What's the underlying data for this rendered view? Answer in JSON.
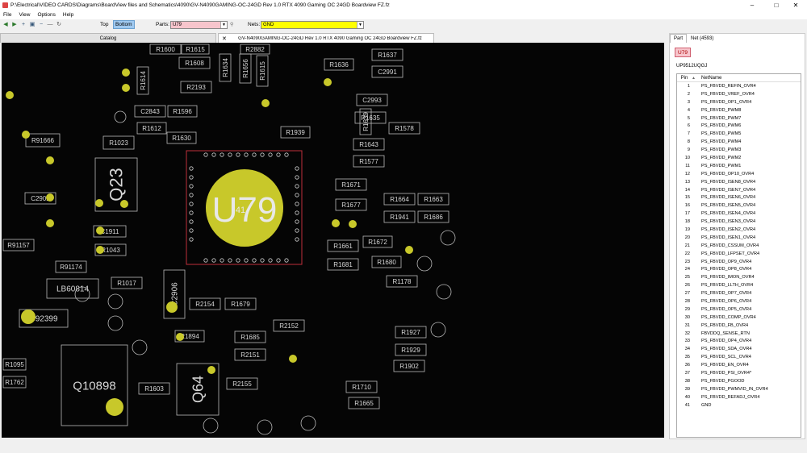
{
  "window": {
    "title": "P:\\Electrical\\VIDEO CARDS\\Diagrams\\BoardView files and Schematics\\4090\\GV-N4090GAMING-OC-24GD Rev 1.0 RTX 4090 Gaming OC 24GD Boardview FZ.fz"
  },
  "menu": [
    "File",
    "View",
    "Options",
    "Help"
  ],
  "toolbar": {
    "top_label": "Top",
    "bottom_label": "Bottom",
    "parts_label": "Parts:",
    "parts_value": "U79",
    "nets_label": "Nets:",
    "nets_value": "GND",
    "colors": {
      "parts_bg": "#f7c5cc",
      "nets_bg": "#ffff00",
      "bottom_bg": "#9fc9f0"
    }
  },
  "tabs": {
    "catalog": "Catalog",
    "file": "GV-N4090GAMING-OC-24GD Rev 1.0 RTX 4090 Gaming OC 24GD Boardview FZ.fz"
  },
  "board": {
    "main_part": "U79",
    "main_pin_label": "41",
    "colors": {
      "background": "#050505",
      "outline": "#b9b9b9",
      "highlight": "#c8c82a",
      "selected": "#c0303a"
    },
    "components": [
      {
        "label": "R1600"
      },
      {
        "label": "R1615"
      },
      {
        "label": "R2882"
      },
      {
        "label": "R1637"
      },
      {
        "label": "R1608"
      },
      {
        "label": "R1636"
      },
      {
        "label": "C2991"
      },
      {
        "label": "R1634"
      },
      {
        "label": "R2193"
      },
      {
        "label": "R1656"
      },
      {
        "label": "R1614"
      },
      {
        "label": "R1615"
      },
      {
        "label": "C2843"
      },
      {
        "label": "R1596"
      },
      {
        "label": "R1639"
      },
      {
        "label": "C2993"
      },
      {
        "label": "R1612"
      },
      {
        "label": "R1635"
      },
      {
        "label": "R1578"
      },
      {
        "label": "R1630"
      },
      {
        "label": "R1939"
      },
      {
        "label": "R1643"
      },
      {
        "label": "R1023"
      },
      {
        "label": "R91666"
      },
      {
        "label": "R1577"
      },
      {
        "label": "Q23"
      },
      {
        "label": "R1671"
      },
      {
        "label": "R1664"
      },
      {
        "label": "R1663"
      },
      {
        "label": "R1677"
      },
      {
        "label": "R1941"
      },
      {
        "label": "R1686"
      },
      {
        "label": "C2902"
      },
      {
        "label": "C1911"
      },
      {
        "label": "R1672"
      },
      {
        "label": "R1661"
      },
      {
        "label": "R1043"
      },
      {
        "label": "R1681"
      },
      {
        "label": "R1680"
      },
      {
        "label": "R91157"
      },
      {
        "label": "R91174"
      },
      {
        "label": "LB60814"
      },
      {
        "label": "R1017"
      },
      {
        "label": "C2906"
      },
      {
        "label": "R2154"
      },
      {
        "label": "R1679"
      },
      {
        "label": "R1178"
      },
      {
        "label": "C92399"
      },
      {
        "label": "R2152"
      },
      {
        "label": "R1894"
      },
      {
        "label": "R1685"
      },
      {
        "label": "R1927"
      },
      {
        "label": "R2151"
      },
      {
        "label": "R1929"
      },
      {
        "label": "Q10898"
      },
      {
        "label": "R1902"
      },
      {
        "label": "R1603"
      },
      {
        "label": "Q64"
      },
      {
        "label": "R2155"
      },
      {
        "label": "R1710"
      },
      {
        "label": "R1665"
      },
      {
        "label": "R1095"
      },
      {
        "label": "R1762"
      }
    ]
  },
  "panel": {
    "tab_part": "Part",
    "tab_net": "Net (4593)",
    "part_name": "U79",
    "part_number": "UP9512UQGJ",
    "col_pin": "Pin",
    "col_netname": "NetName",
    "sort_icon": "sort-up-icon",
    "pins": [
      {
        "pin": "1",
        "net": "PS_FBVDD_REFIN_OVR4"
      },
      {
        "pin": "2",
        "net": "PS_FBVDD_VREF_OVR4"
      },
      {
        "pin": "3",
        "net": "PS_FBVDD_OP1_OVR4"
      },
      {
        "pin": "4",
        "net": "PS_FBVDD_PWM8"
      },
      {
        "pin": "5",
        "net": "PS_FBVDD_PWM7"
      },
      {
        "pin": "6",
        "net": "PS_FBVDD_PWM6"
      },
      {
        "pin": "7",
        "net": "PS_FBVDD_PWM5"
      },
      {
        "pin": "8",
        "net": "PS_FBVDD_PWM4"
      },
      {
        "pin": "9",
        "net": "PS_FBVDD_PWM3"
      },
      {
        "pin": "10",
        "net": "PS_FBVDD_PWM2"
      },
      {
        "pin": "11",
        "net": "PS_FBVDD_PWM1"
      },
      {
        "pin": "12",
        "net": "PS_FBVDD_OP10_OVR4"
      },
      {
        "pin": "13",
        "net": "PS_FBVDD_ISEN8_OVR4"
      },
      {
        "pin": "14",
        "net": "PS_FBVDD_ISEN7_OVR4"
      },
      {
        "pin": "15",
        "net": "PS_FBVDD_ISEN6_OVR4"
      },
      {
        "pin": "16",
        "net": "PS_FBVDD_ISEN5_OVR4"
      },
      {
        "pin": "17",
        "net": "PS_FBVDD_ISEN4_OVR4"
      },
      {
        "pin": "18",
        "net": "PS_FBVDD_ISEN3_OVR4"
      },
      {
        "pin": "19",
        "net": "PS_FBVDD_ISEN2_OVR4"
      },
      {
        "pin": "20",
        "net": "PS_FBVDD_ISEN1_OVR4"
      },
      {
        "pin": "21",
        "net": "PS_FBVDD_CSSUM_OVR4"
      },
      {
        "pin": "22",
        "net": "PS_FBVDD_LFPSET_OVR4"
      },
      {
        "pin": "23",
        "net": "PS_FBVDD_OP9_OVR4"
      },
      {
        "pin": "24",
        "net": "PS_FBVDD_OP8_OVR4"
      },
      {
        "pin": "25",
        "net": "PS_FBVDD_IMON_OVR4"
      },
      {
        "pin": "26",
        "net": "PS_FBVDD_LLTH_OVR4"
      },
      {
        "pin": "27",
        "net": "PS_FBVDD_OP7_OVR4"
      },
      {
        "pin": "28",
        "net": "PS_FBVDD_OP6_OVR4"
      },
      {
        "pin": "29",
        "net": "PS_FBVDD_OP5_OVR4"
      },
      {
        "pin": "30",
        "net": "PS_FBVDD_COMP_OVR4"
      },
      {
        "pin": "31",
        "net": "PS_FBVDD_FB_OVR4"
      },
      {
        "pin": "32",
        "net": "FBVDDQ_SENSE_RTN"
      },
      {
        "pin": "33",
        "net": "PS_FBVDD_OP4_OVR4"
      },
      {
        "pin": "34",
        "net": "PS_FBVDD_SDA_OVR4"
      },
      {
        "pin": "35",
        "net": "PS_FBVDD_SCL_OVR4"
      },
      {
        "pin": "36",
        "net": "PS_FBVDD_EN_OVR4"
      },
      {
        "pin": "37",
        "net": "PS_FBVDD_PSI_OVR4*"
      },
      {
        "pin": "38",
        "net": "PS_FBVDD_PGOOD"
      },
      {
        "pin": "39",
        "net": "PS_FBVDD_PWMVID_IN_OVR4"
      },
      {
        "pin": "40",
        "net": "PS_FBVDD_REFADJ_OVR4"
      },
      {
        "pin": "41",
        "net": "GND"
      }
    ]
  }
}
